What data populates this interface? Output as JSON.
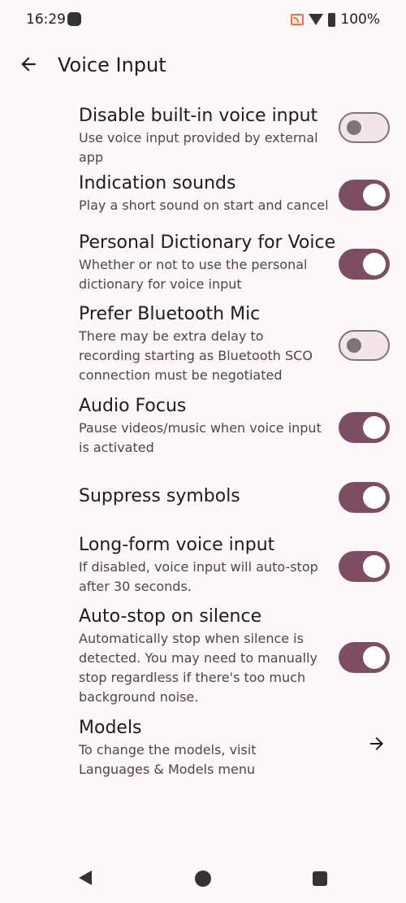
{
  "status": {
    "time": "16:29",
    "battery": "100%"
  },
  "appbar": {
    "title": "Voice Input"
  },
  "settings": [
    {
      "title": "Disable built-in voice input",
      "summary": "Use voice input provided by external app",
      "checked": false
    },
    {
      "title": "Indication sounds",
      "summary": "Play a short sound on start and cancel",
      "checked": true
    },
    {
      "title": "Personal Dictionary for Voice",
      "summary": "Whether or not to use the personal dictionary for voice input",
      "checked": true
    },
    {
      "title": "Prefer Bluetooth Mic",
      "summary": "There may be extra delay to recording starting as Bluetooth SCO connection must be negotiated",
      "checked": false
    },
    {
      "title": "Audio Focus",
      "summary": "Pause videos/music when voice input is activated",
      "checked": true
    },
    {
      "title": "Suppress symbols",
      "summary": "",
      "checked": true
    },
    {
      "title": "Long-form voice input",
      "summary": "If disabled, voice input will auto-stop after 30 seconds.",
      "checked": true
    },
    {
      "title": "Auto-stop on silence",
      "summary": "Automatically stop when silence is detected. You may need to manually stop regardless if there's too much background noise.",
      "checked": true
    }
  ],
  "models": {
    "title": "Models",
    "summary": "To change the models, visit Languages & Models menu"
  },
  "colors": {
    "accent": "#7d4e63",
    "background": "#fdf7f8"
  }
}
